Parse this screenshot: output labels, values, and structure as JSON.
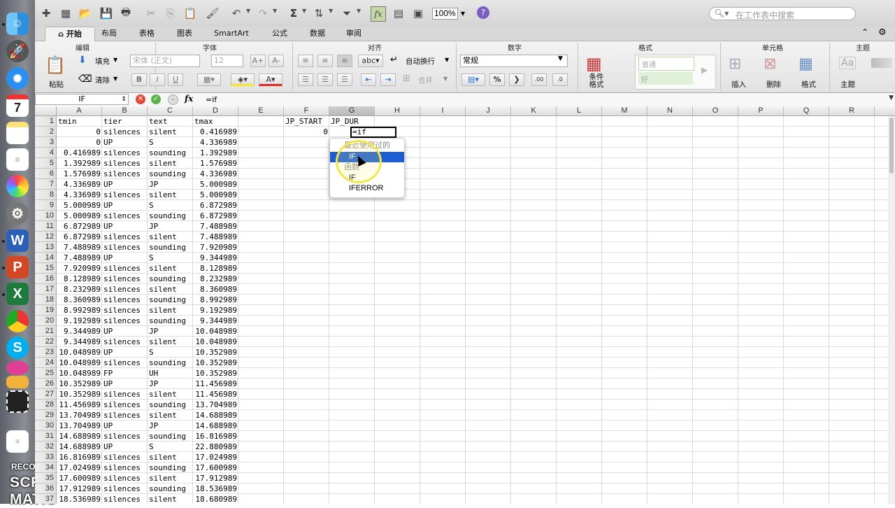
{
  "toolbar": {
    "zoom": "100%",
    "search_placeholder": "在工作表中搜索"
  },
  "ribbon_tabs": [
    {
      "label": "开始",
      "active": true
    },
    {
      "label": "布局"
    },
    {
      "label": "表格"
    },
    {
      "label": "图表"
    },
    {
      "label": "SmartArt"
    },
    {
      "label": "公式"
    },
    {
      "label": "数据"
    },
    {
      "label": "审阅"
    }
  ],
  "ribbon": {
    "groups": {
      "edit": "编辑",
      "font": "字体",
      "align": "对齐",
      "number": "数字",
      "format": "格式",
      "cells": "单元格",
      "theme": "主题"
    },
    "paste": "粘贴",
    "fill": "填充",
    "clear": "清除",
    "font_name": "宋体 (正文)",
    "font_size": "12",
    "wrap_text": "自动换行",
    "wrap_prefix": "abc",
    "merge": "合并",
    "number_format": "常规",
    "conditional_format": "条件格式",
    "style_normal": "普通",
    "style_good": "好",
    "insert": "插入",
    "delete": "删除",
    "format_btn": "格式",
    "theme_btn": "主题",
    "theme_aa": "Aa"
  },
  "formula_bar": {
    "name_box": "IF",
    "fx": "fx",
    "formula": "=if"
  },
  "columns": [
    "A",
    "B",
    "C",
    "D",
    "E",
    "F",
    "G",
    "H",
    "I",
    "J",
    "K",
    "L",
    "M",
    "N",
    "O",
    "P",
    "Q",
    "R"
  ],
  "selected_column": "G",
  "rows": [
    {
      "n": "1",
      "a": "tmin",
      "b": "tier",
      "c": "text",
      "d": "tmax",
      "f": "JP_START",
      "g": "JP_DUR"
    },
    {
      "n": "2",
      "a": "0",
      "b": "silences",
      "c": "silent",
      "d": "0.416989",
      "f": "0"
    },
    {
      "n": "3",
      "a": "0",
      "b": "UP",
      "c": "S",
      "d": "4.336989"
    },
    {
      "n": "4",
      "a": "0.416989",
      "b": "silences",
      "c": "sounding",
      "d": "1.392989"
    },
    {
      "n": "5",
      "a": "1.392989",
      "b": "silences",
      "c": "silent",
      "d": "1.576989"
    },
    {
      "n": "6",
      "a": "1.576989",
      "b": "silences",
      "c": "sounding",
      "d": "4.336989"
    },
    {
      "n": "7",
      "a": "4.336989",
      "b": "UP",
      "c": "JP",
      "d": "5.000989"
    },
    {
      "n": "8",
      "a": "4.336989",
      "b": "silences",
      "c": "silent",
      "d": "5.000989"
    },
    {
      "n": "9",
      "a": "5.000989",
      "b": "UP",
      "c": "S",
      "d": "6.872989"
    },
    {
      "n": "10",
      "a": "5.000989",
      "b": "silences",
      "c": "sounding",
      "d": "6.872989"
    },
    {
      "n": "11",
      "a": "6.872989",
      "b": "UP",
      "c": "JP",
      "d": "7.488989"
    },
    {
      "n": "12",
      "a": "6.872989",
      "b": "silences",
      "c": "silent",
      "d": "7.488989"
    },
    {
      "n": "13",
      "a": "7.488989",
      "b": "silences",
      "c": "sounding",
      "d": "7.920989"
    },
    {
      "n": "14",
      "a": "7.488989",
      "b": "UP",
      "c": "S",
      "d": "9.344989"
    },
    {
      "n": "15",
      "a": "7.920989",
      "b": "silences",
      "c": "silent",
      "d": "8.128989"
    },
    {
      "n": "16",
      "a": "8.128989",
      "b": "silences",
      "c": "sounding",
      "d": "8.232989"
    },
    {
      "n": "17",
      "a": "8.232989",
      "b": "silences",
      "c": "silent",
      "d": "8.360989"
    },
    {
      "n": "18",
      "a": "8.360989",
      "b": "silences",
      "c": "sounding",
      "d": "8.992989"
    },
    {
      "n": "19",
      "a": "8.992989",
      "b": "silences",
      "c": "silent",
      "d": "9.192989"
    },
    {
      "n": "20",
      "a": "9.192989",
      "b": "silences",
      "c": "sounding",
      "d": "9.344989"
    },
    {
      "n": "21",
      "a": "9.344989",
      "b": "UP",
      "c": "JP",
      "d": "10.048989"
    },
    {
      "n": "22",
      "a": "9.344989",
      "b": "silences",
      "c": "silent",
      "d": "10.048989"
    },
    {
      "n": "23",
      "a": "10.048989",
      "b": "UP",
      "c": "S",
      "d": "10.352989"
    },
    {
      "n": "24",
      "a": "10.048989",
      "b": "silences",
      "c": "sounding",
      "d": "10.352989"
    },
    {
      "n": "25",
      "a": "10.048989",
      "b": "FP",
      "c": "UH",
      "d": "10.352989"
    },
    {
      "n": "26",
      "a": "10.352989",
      "b": "UP",
      "c": "JP",
      "d": "11.456989"
    },
    {
      "n": "27",
      "a": "10.352989",
      "b": "silences",
      "c": "silent",
      "d": "11.456989"
    },
    {
      "n": "28",
      "a": "11.456989",
      "b": "silences",
      "c": "sounding",
      "d": "13.704989"
    },
    {
      "n": "29",
      "a": "13.704989",
      "b": "silences",
      "c": "silent",
      "d": "14.688989"
    },
    {
      "n": "30",
      "a": "13.704989",
      "b": "UP",
      "c": "JP",
      "d": "14.688989"
    },
    {
      "n": "31",
      "a": "14.688989",
      "b": "silences",
      "c": "sounding",
      "d": "16.816989"
    },
    {
      "n": "32",
      "a": "14.688989",
      "b": "UP",
      "c": "S",
      "d": "22.880989"
    },
    {
      "n": "33",
      "a": "16.816989",
      "b": "silences",
      "c": "silent",
      "d": "17.024989"
    },
    {
      "n": "34",
      "a": "17.024989",
      "b": "silences",
      "c": "sounding",
      "d": "17.600989"
    },
    {
      "n": "35",
      "a": "17.600989",
      "b": "silences",
      "c": "silent",
      "d": "17.912989"
    },
    {
      "n": "36",
      "a": "17.912989",
      "b": "silences",
      "c": "sounding",
      "d": "18.536989"
    },
    {
      "n": "37",
      "a": "18.536989",
      "b": "silences",
      "c": "silent",
      "d": "18.680989"
    }
  ],
  "active_cell": {
    "ref": "G2",
    "value": "=if"
  },
  "autocomplete": {
    "recent_header": "最近使用过的",
    "recent_items": [
      "IF"
    ],
    "functions_header": "函数",
    "function_items": [
      "IF",
      "IFERROR"
    ]
  },
  "watermark": {
    "line1": "RECORDED WITH",
    "line2": "SCREENCAST",
    "line3": "MATIC"
  }
}
